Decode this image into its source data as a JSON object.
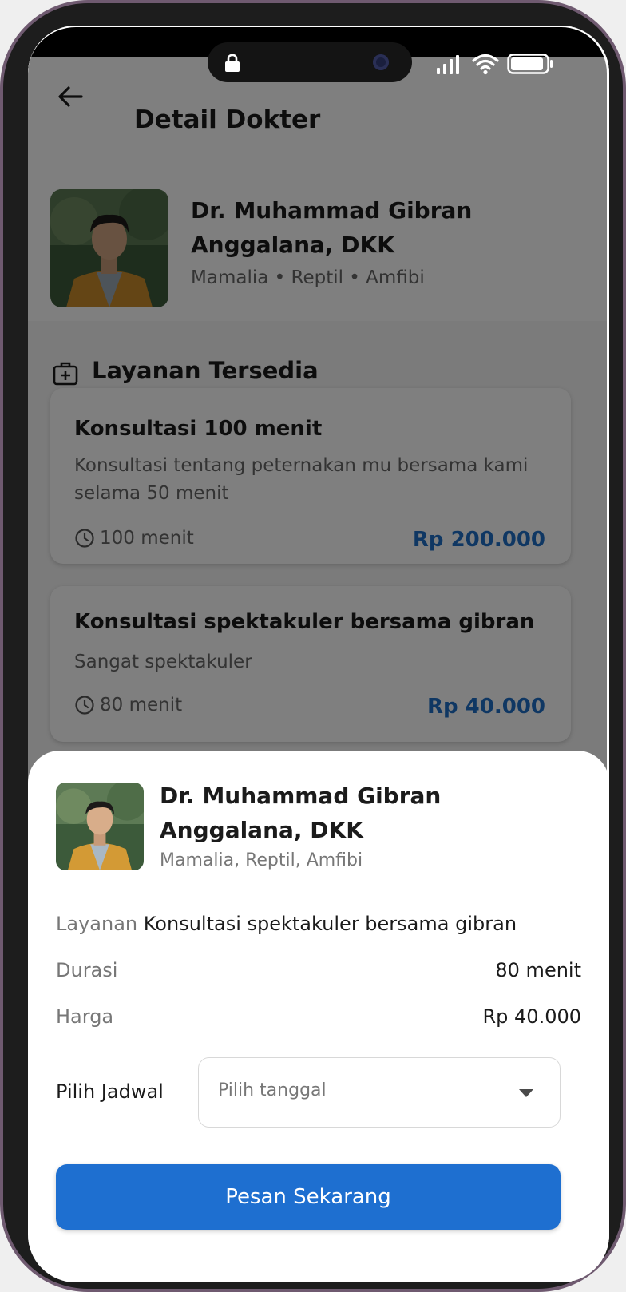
{
  "header": {
    "title": "Detail Dokter"
  },
  "doctor": {
    "name": "Dr. Muhammad Gibran Anggalana, DKK",
    "specialties_dot": "Mamalia • Reptil • Amfibi",
    "specialties_comma": "Mamalia, Reptil, Amfibi"
  },
  "services_section": {
    "title": "Layanan Tersedia",
    "items": [
      {
        "title": "Konsultasi 100 menit",
        "description": "Konsultasi tentang peternakan mu bersama kami selama 50 menit",
        "duration": "100 menit",
        "price": "Rp 200.000"
      },
      {
        "title": "Konsultasi spektakuler bersama gibran",
        "description": "Sangat spektakuler",
        "duration": "80 menit",
        "price": "Rp 40.000"
      }
    ]
  },
  "sheet": {
    "service_label": "Layanan",
    "service_value": "Konsultasi spektakuler bersama gibran",
    "duration_label": "Durasi",
    "duration_value": "80 menit",
    "price_label": "Harga",
    "price_value": "Rp 40.000",
    "schedule_label": "Pilih Jadwal",
    "date_placeholder": "Pilih tanggal",
    "order_button": "Pesan Sekarang"
  },
  "colors": {
    "primary": "#1e6fd0",
    "price": "#1e6fc7",
    "frame_border": "#6f5a70"
  }
}
